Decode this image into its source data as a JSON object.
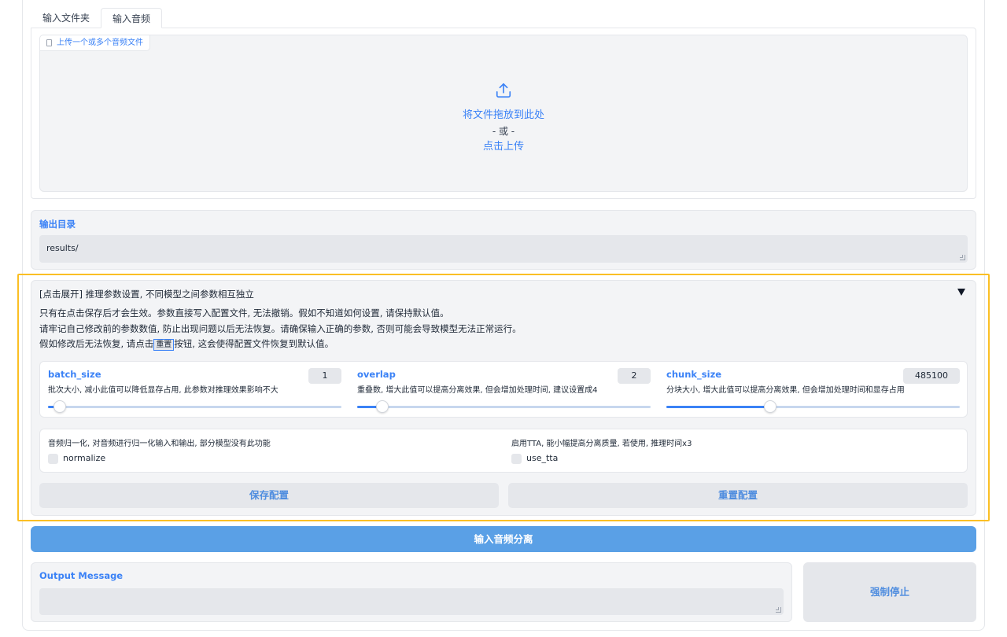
{
  "tabs": [
    {
      "label": "输入文件夹",
      "active": false
    },
    {
      "label": "输入音频",
      "active": true
    }
  ],
  "upload": {
    "label": "上传一个或多个音频文件",
    "drop_text": "将文件拖放到此处",
    "or_text": "- 或 -",
    "click_text": "点击上传"
  },
  "output_dir": {
    "label": "输出目录",
    "value": "results/"
  },
  "inference": {
    "title": "[点击展开] 推理参数设置, 不同模型之间参数相互独立",
    "line1": "只有在点击保存后才会生效。参数直接写入配置文件, 无法撤销。假如不知道如何设置, 请保持默认值。",
    "line2": "请牢记自己修改前的参数数值, 防止出现问题以后无法恢复。请确保输入正确的参数, 否则可能会导致模型无法正常运行。",
    "line3_before": "假如修改后无法恢复, 请点击",
    "line3_code": "重置",
    "line3_after": "按钮, 这会使得配置文件恢复到默认值。",
    "sliders": [
      {
        "name": "batch_size",
        "desc": "批次大小, 减小此值可以降低显存占用, 此参数对推理效果影响不大",
        "value": "1",
        "fraction": 0.04
      },
      {
        "name": "overlap",
        "desc": "重叠数, 增大此值可以提高分离效果, 但会增加处理时间, 建议设置成4",
        "value": "2",
        "fraction": 0.085
      },
      {
        "name": "chunk_size",
        "desc": "分块大小, 增大此值可以提高分离效果, 但会增加处理时间和显存占用",
        "value": "485100",
        "fraction": 0.355
      }
    ],
    "checks": [
      {
        "desc": "音频归一化, 对音频进行归一化输入和输出, 部分模型没有此功能",
        "label": "normalize",
        "checked": false
      },
      {
        "desc": "启用TTA, 能小幅提高分离质量, 若使用, 推理时间x3",
        "label": "use_tta",
        "checked": false
      }
    ],
    "save_label": "保存配置",
    "reset_label": "重置配置"
  },
  "run_label": "输入音频分离",
  "output_message": {
    "label": "Output Message",
    "value": ""
  },
  "stop_label": "强制停止",
  "colors": {
    "accent": "#3b82f6",
    "primary_button": "#5aa0e6",
    "highlight": "#fbbf24"
  }
}
